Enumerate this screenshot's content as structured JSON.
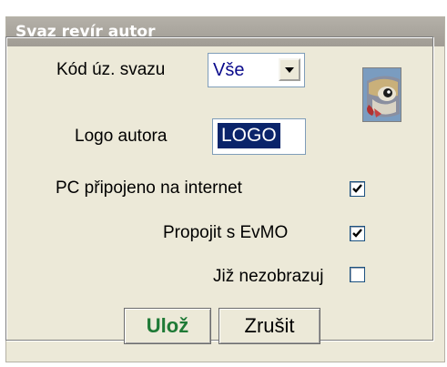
{
  "dialog": {
    "title": "Svaz revír autor"
  },
  "form": {
    "kod_label": "Kód úz. svazu",
    "kod_value": "Vše",
    "logo_label": "Logo autora",
    "logo_value": "LOGO",
    "pc_label": "PC připojeno na internet",
    "pc_checked": true,
    "evmo_label": "Propojit s EvMO",
    "evmo_checked": true,
    "hide_label": "Již nezobrazuj",
    "hide_checked": false
  },
  "buttons": {
    "save": "Ulož",
    "cancel": "Zrušit"
  },
  "icons": {
    "combo_arrow": "chevron-down-icon",
    "fish": "fish-icon",
    "check": "checkmark-icon"
  },
  "colors": {
    "save_text": "#1f7a36",
    "selection": "#0a246a",
    "combo_text": "#0a0a8c"
  }
}
